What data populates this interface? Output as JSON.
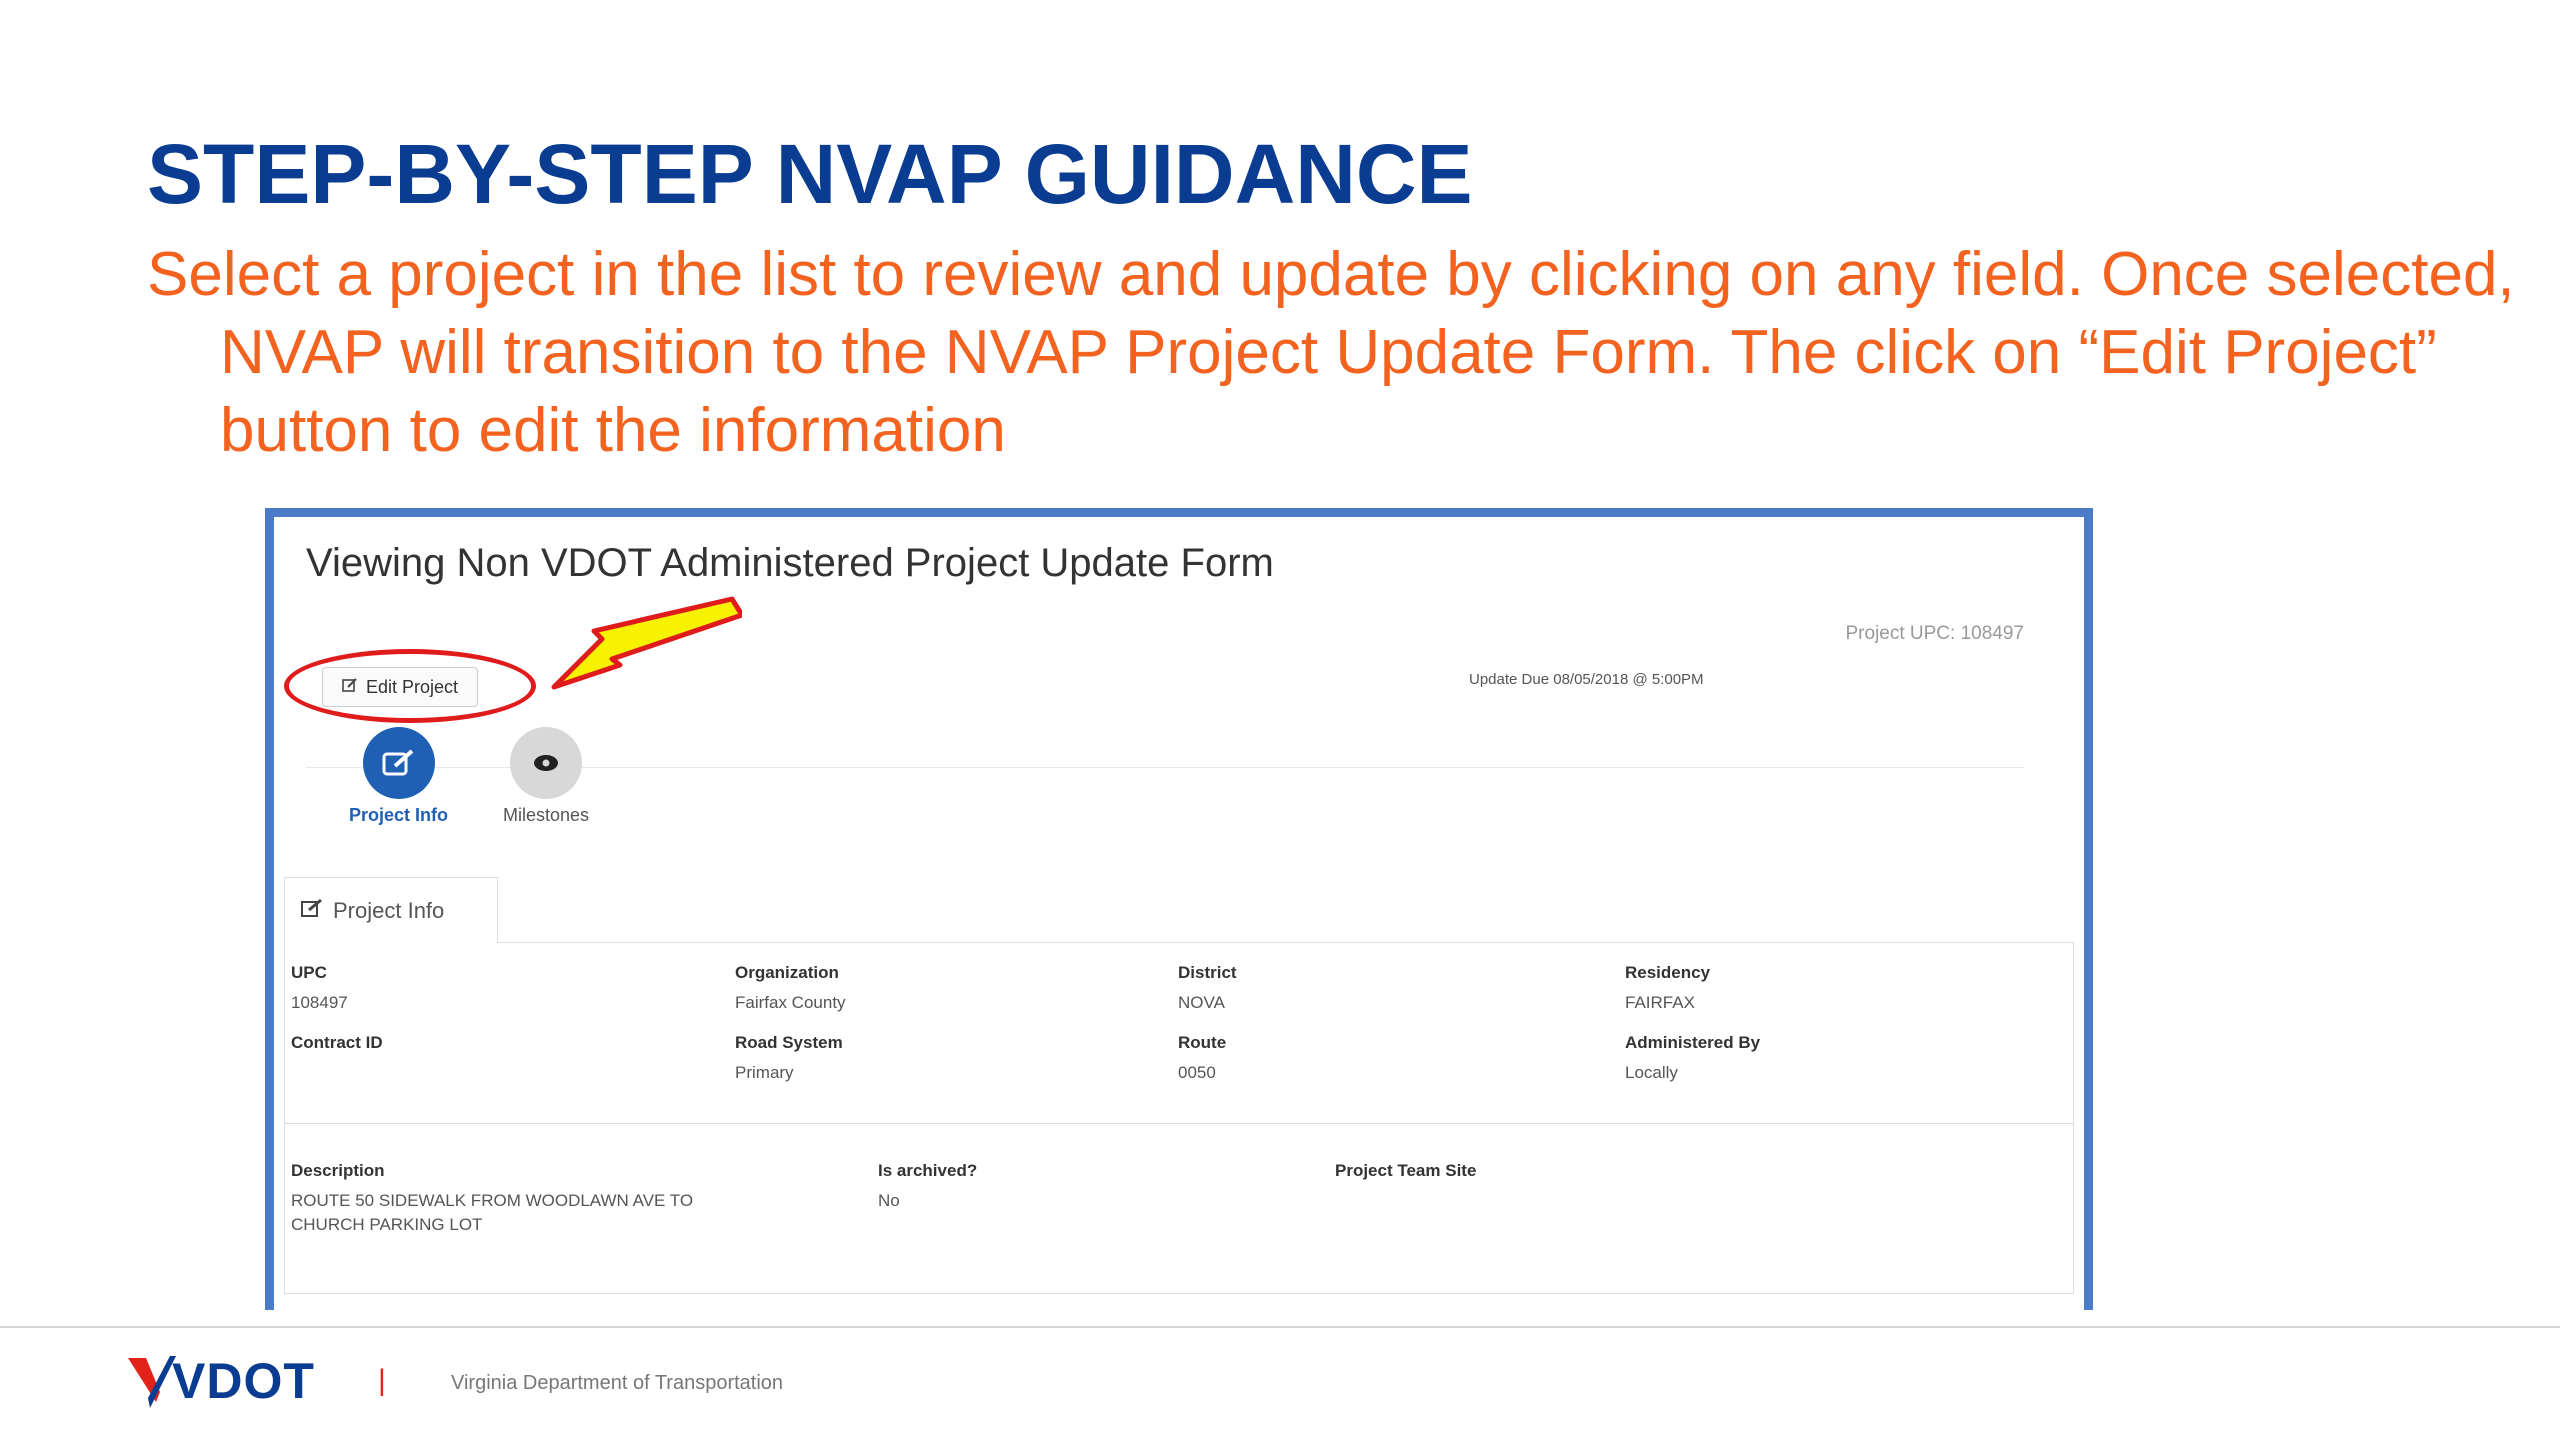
{
  "slide": {
    "title": "STEP-BY-STEP NVAP GUIDANCE",
    "body": "Select a project in the list to review and update by clicking on any field.  Once selected, NVAP will transition to the NVAP Project Update Form.  The click on “Edit Project” button to edit the information"
  },
  "form": {
    "title": "Viewing Non VDOT Administered Project Update Form",
    "upc_header": "Project UPC: 108497",
    "update_due": "Update Due 08/05/2018 @ 5:00PM",
    "edit_button": "Edit Project",
    "steps": [
      {
        "label": "Project Info",
        "icon": "edit-icon",
        "state": "active"
      },
      {
        "label": "Milestones",
        "icon": "eye-icon",
        "state": "inactive"
      }
    ],
    "tab_label": "Project Info",
    "fields": {
      "upc": {
        "label": "UPC",
        "value": "108497"
      },
      "organization": {
        "label": "Organization",
        "value": "Fairfax County"
      },
      "district": {
        "label": "District",
        "value": "NOVA"
      },
      "residency": {
        "label": "Residency",
        "value": "FAIRFAX"
      },
      "contract_id": {
        "label": "Contract ID",
        "value": ""
      },
      "road_system": {
        "label": "Road System",
        "value": "Primary"
      },
      "route": {
        "label": "Route",
        "value": "0050"
      },
      "administered_by": {
        "label": "Administered By",
        "value": "Locally"
      },
      "description": {
        "label": "Description",
        "value_line1": "ROUTE 50 SIDEWALK FROM WOODLAWN AVE TO",
        "value_line2": "CHURCH PARKING LOT"
      },
      "is_archived": {
        "label": "Is archived?",
        "value": "No"
      },
      "team_site": {
        "label": "Project Team Site",
        "value": ""
      }
    }
  },
  "footer": {
    "logo_text": "VDOT",
    "separator": "|",
    "org_name": "Virginia Department of Transportation"
  },
  "colors": {
    "title_blue": "#0a3d91",
    "body_orange": "#f4621f",
    "frame_blue": "#4a7cc7",
    "highlight_red": "#e01b1b",
    "arrow_yellow": "#f7f200"
  }
}
